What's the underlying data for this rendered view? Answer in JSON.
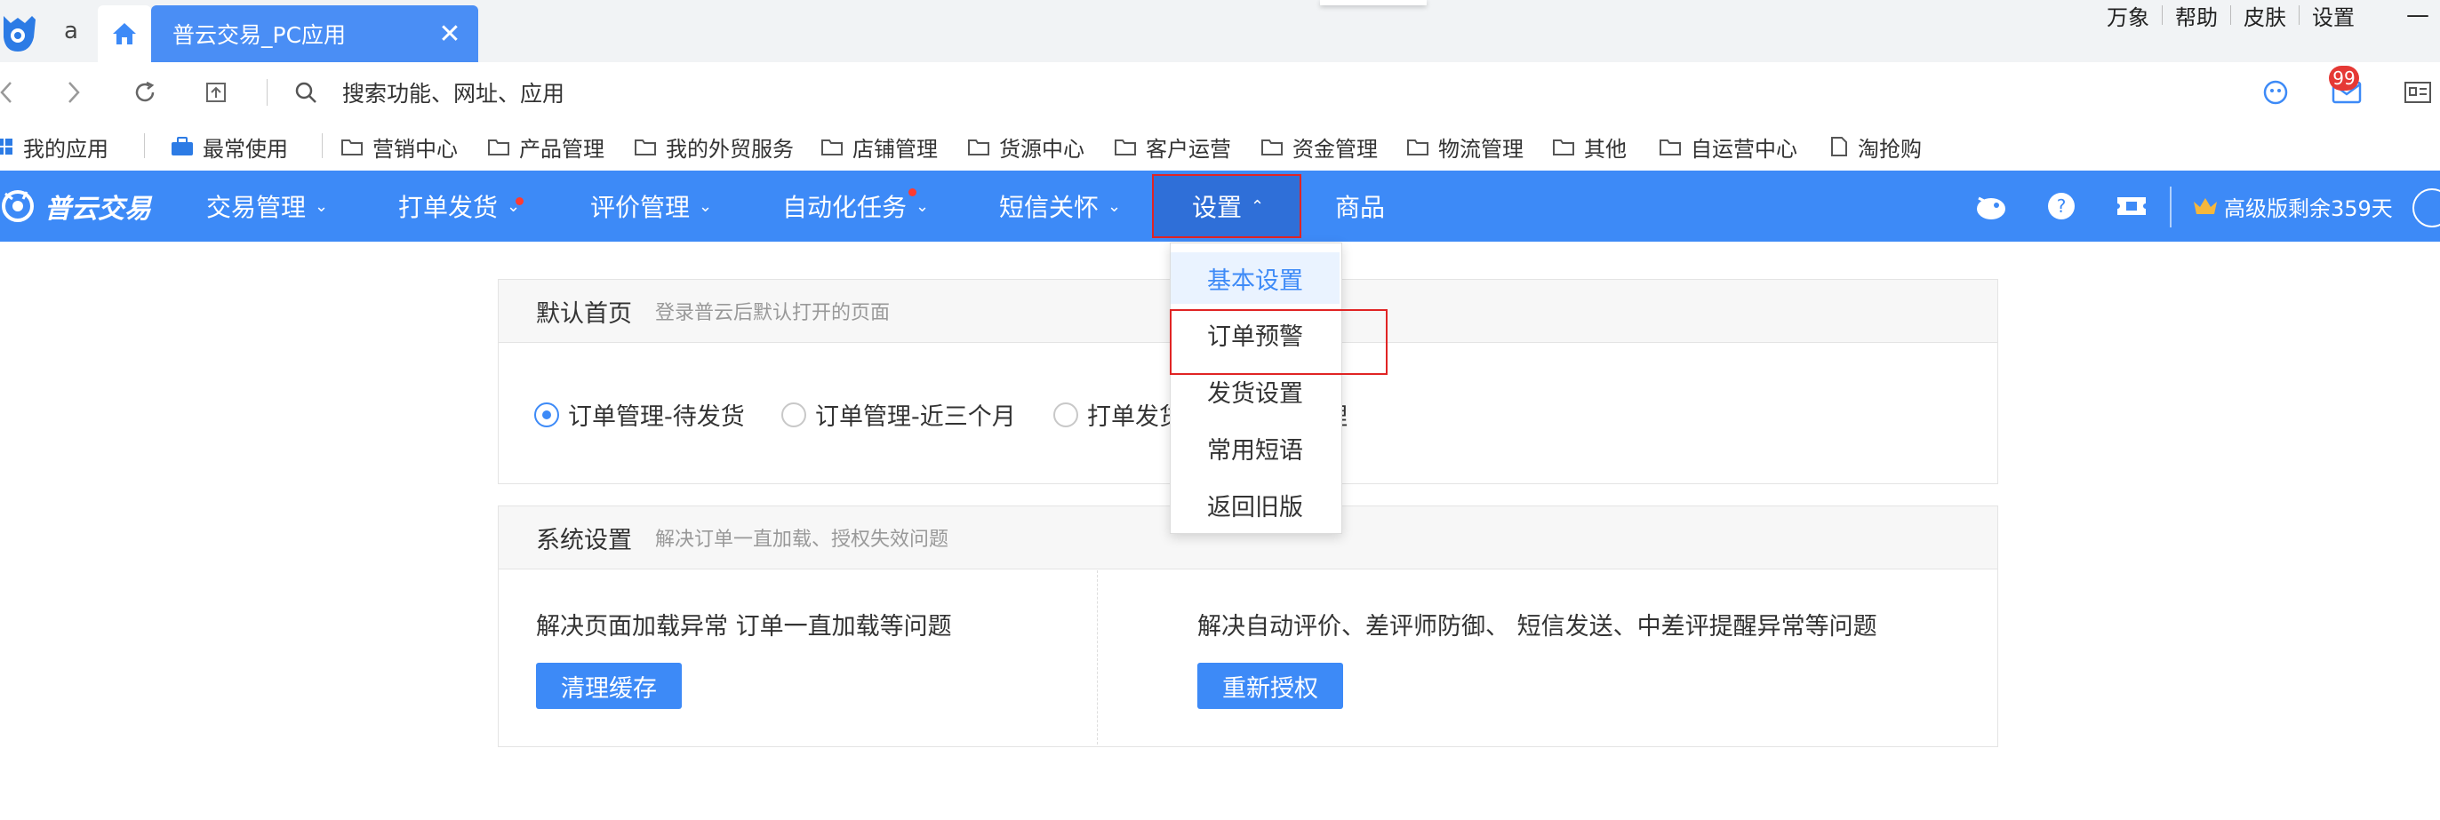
{
  "browser": {
    "tab_short": "a",
    "active_tab_title": "普云交易_PC应用",
    "tab_close_glyph": "✕",
    "top_links": [
      "万象",
      "帮助",
      "皮肤",
      "设置"
    ],
    "minimize_glyph": "—",
    "address_placeholder": "搜索功能、网址、应用",
    "mail_badge": "99"
  },
  "bookmarks": [
    {
      "label": "我的应用",
      "icon": "app-grid-icon"
    },
    {
      "label": "最常使用",
      "icon": "briefcase-icon"
    },
    {
      "label": "营销中心",
      "icon": "folder-icon"
    },
    {
      "label": "产品管理",
      "icon": "folder-icon"
    },
    {
      "label": "我的外贸服务",
      "icon": "folder-icon"
    },
    {
      "label": "店铺管理",
      "icon": "folder-icon"
    },
    {
      "label": "货源中心",
      "icon": "folder-icon"
    },
    {
      "label": "客户运营",
      "icon": "folder-icon"
    },
    {
      "label": "资金管理",
      "icon": "folder-icon"
    },
    {
      "label": "物流管理",
      "icon": "folder-icon"
    },
    {
      "label": "其他",
      "icon": "folder-icon"
    },
    {
      "label": "自运营中心",
      "icon": "folder-icon"
    },
    {
      "label": "淘抢购",
      "icon": "document-icon"
    }
  ],
  "app_nav": {
    "logo_text": "普云交易",
    "items": [
      {
        "label": "交易管理",
        "has_chevron": true,
        "has_dot": false
      },
      {
        "label": "打单发货",
        "has_chevron": true,
        "has_dot": true
      },
      {
        "label": "评价管理",
        "has_chevron": true,
        "has_dot": false
      },
      {
        "label": "自动化任务",
        "has_chevron": true,
        "has_dot": true
      },
      {
        "label": "短信关怀",
        "has_chevron": true,
        "has_dot": false
      },
      {
        "label": "设置",
        "has_chevron": true,
        "has_dot": false,
        "open": true
      },
      {
        "label": "商品",
        "has_chevron": false,
        "has_dot": false
      }
    ],
    "chevron_down": "⌄",
    "chevron_up": "⌃",
    "vip_text": "高级版剩余359天"
  },
  "settings_dropdown": {
    "items": [
      "基本设置",
      "订单预警",
      "发货设置",
      "常用短语",
      "返回旧版"
    ],
    "active_index": 0,
    "highlighted_index": 1
  },
  "default_home": {
    "title": "默认首页",
    "subtitle": "登录普云后默认打开的页面",
    "options": [
      "订单管理-待发货",
      "订单管理-近三个月",
      "打单发货",
      "理"
    ],
    "selected_index": 0
  },
  "system_settings": {
    "title": "系统设置",
    "subtitle": "解决订单一直加载、授权失效问题",
    "left_desc": "解决页面加载异常 订单一直加载等问题",
    "left_button": "清理缓存",
    "right_desc": "解决自动评价、差评师防御、 短信发送、中差评提醒异常等问题",
    "right_button": "重新授权"
  },
  "colors": {
    "brand_blue": "#3d8af7",
    "tab_blue": "#4a8ef5",
    "highlight_red": "#e02424",
    "badge_red": "#e53935"
  }
}
